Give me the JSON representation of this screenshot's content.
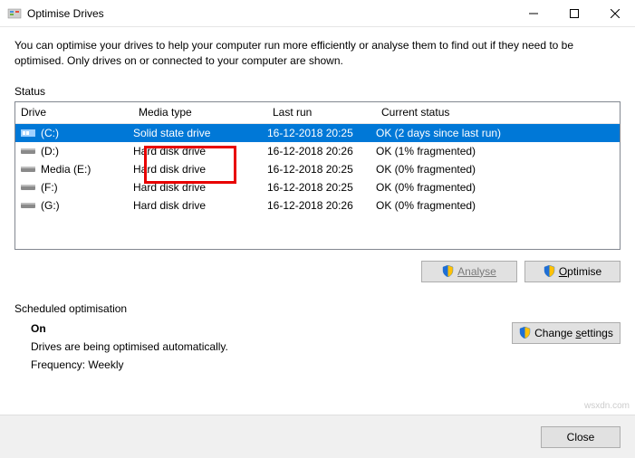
{
  "window": {
    "title": "Optimise Drives"
  },
  "description": "You can optimise your drives to help your computer run more efficiently or analyse them to find out if they need to be optimised. Only drives on or connected to your computer are shown.",
  "status_label": "Status",
  "columns": {
    "drive": "Drive",
    "media": "Media type",
    "last": "Last run",
    "status": "Current status"
  },
  "drives": [
    {
      "name": "(C:)",
      "media": "Solid state drive",
      "last": "16-12-2018 20:25",
      "status": "OK (2 days since last run)",
      "icon": "ssd",
      "selected": true
    },
    {
      "name": "(D:)",
      "media": "Hard disk drive",
      "last": "16-12-2018 20:26",
      "status": "OK (1% fragmented)",
      "icon": "hdd",
      "selected": false
    },
    {
      "name": "Media (E:)",
      "media": "Hard disk drive",
      "last": "16-12-2018 20:25",
      "status": "OK (0% fragmented)",
      "icon": "hdd",
      "selected": false
    },
    {
      "name": "(F:)",
      "media": "Hard disk drive",
      "last": "16-12-2018 20:25",
      "status": "OK (0% fragmented)",
      "icon": "hdd",
      "selected": false
    },
    {
      "name": "(G:)",
      "media": "Hard disk drive",
      "last": "16-12-2018 20:26",
      "status": "OK (0% fragmented)",
      "icon": "hdd",
      "selected": false
    }
  ],
  "buttons": {
    "analyse": "Analyse",
    "optimise": "Optimise",
    "change_settings": "Change settings",
    "close": "Close"
  },
  "scheduled": {
    "label": "Scheduled optimisation",
    "state": "On",
    "line1": "Drives are being optimised automatically.",
    "line2": "Frequency: Weekly"
  },
  "watermark": "wsxdn.com"
}
